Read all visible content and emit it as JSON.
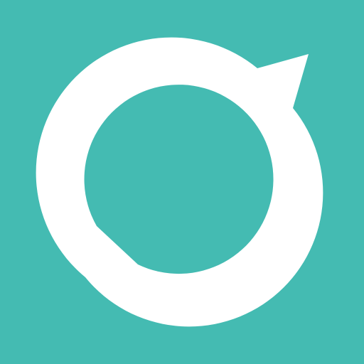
{
  "icon": {
    "name": "chat-bubble-ring-logo",
    "background_color": "#44BBB2",
    "foreground_color": "#FFFFFF"
  }
}
